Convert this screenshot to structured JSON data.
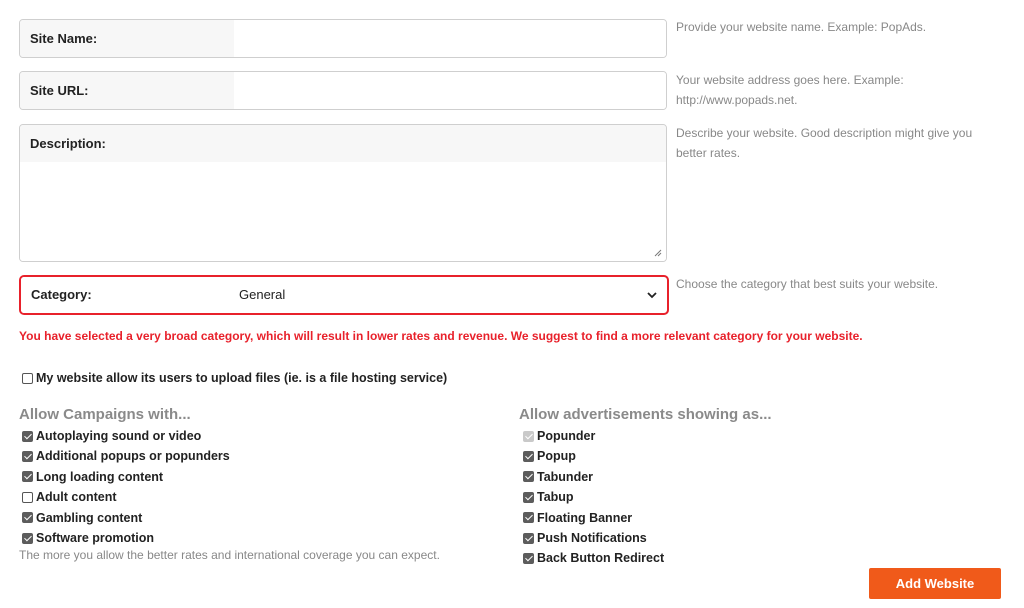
{
  "form": {
    "site_name": {
      "label": "Site Name:",
      "value": "",
      "hint": "Provide your website name. Example: PopAds."
    },
    "site_url": {
      "label": "Site URL:",
      "value": "",
      "hint_line1": "Your website address goes here. Example:",
      "hint_line2": "http://www.popads.net."
    },
    "description": {
      "label": "Description:",
      "value": "",
      "hint_line1": "Describe your website. Good description might give you",
      "hint_line2": "better rates."
    },
    "category": {
      "label": "Category:",
      "selected": "General",
      "hint": "Choose the category that best suits your website."
    },
    "warning": "You have selected a very broad category, which will result in lower rates and revenue. We suggest to find a more relevant category for your website.",
    "upload_option": {
      "label": "My website allow its users to upload files (ie. is a file hosting service)",
      "checked": false
    }
  },
  "campaigns": {
    "title": "Allow Campaigns with...",
    "items": [
      {
        "label": "Autoplaying sound or video",
        "checked": true
      },
      {
        "label": "Additional popups or popunders",
        "checked": true
      },
      {
        "label": "Long loading content",
        "checked": true
      },
      {
        "label": "Adult content",
        "checked": false
      },
      {
        "label": "Gambling content",
        "checked": true
      },
      {
        "label": "Software promotion",
        "checked": true
      }
    ],
    "note": "The more you allow the better rates and international coverage you can expect."
  },
  "ads": {
    "title": "Allow advertisements showing as...",
    "items": [
      {
        "label": "Popunder",
        "checked": true,
        "disabled": true
      },
      {
        "label": "Popup",
        "checked": true
      },
      {
        "label": "Tabunder",
        "checked": true
      },
      {
        "label": "Tabup",
        "checked": true
      },
      {
        "label": "Floating Banner",
        "checked": true
      },
      {
        "label": "Push Notifications",
        "checked": true
      },
      {
        "label": "Back Button Redirect",
        "checked": true
      }
    ]
  },
  "submit_label": "Add Website",
  "colors": {
    "accent": "#f05a1a",
    "error": "#e8212b"
  }
}
